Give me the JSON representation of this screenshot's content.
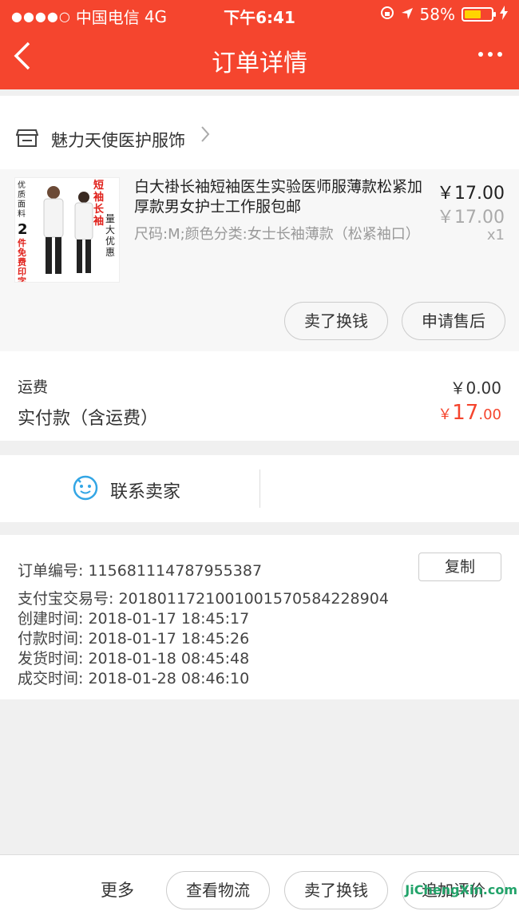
{
  "status_bar": {
    "carrier": "中国电信",
    "network": "4G",
    "time": "下午6:41",
    "battery": "58%"
  },
  "navbar": {
    "title": "订单详情"
  },
  "store": {
    "name": "魅力天使医护服饰"
  },
  "product": {
    "title": "白大褂长袖短袖医生实验医师服薄款松紧加厚款男女护士工作服包邮",
    "sku": "尺码:M;颜色分类:女士长袖薄款（松紧袖口）",
    "price": "￥17.00",
    "original_price": "￥17.00",
    "quantity": "x1",
    "thumbnail_text": {
      "left": "优质面料",
      "count": "2",
      "banner": "件免费印字",
      "red": "短袖 长袖",
      "right": "量大优惠"
    },
    "actions": [
      "卖了换钱",
      "申请售后"
    ]
  },
  "fees": {
    "shipping_label": "运费",
    "shipping_value": "￥0.00",
    "paid_label": "实付款（含运费）",
    "paid_currency": "￥",
    "paid_integer": "17",
    "paid_decimal": ".00"
  },
  "contact": {
    "label": "联系卖家"
  },
  "order_info": {
    "copy_label": "复制",
    "rows": [
      "订单编号:   115681114787955387",
      "支付宝交易号:   20180117210010015705842289​04",
      "创建时间:   2018-01-17 18:45:17",
      "付款时间:   2018-01-17 18:45:26",
      "发货时间:   2018-01-18 08:45:48",
      "成交时间:   2018-01-28 08:46:10"
    ]
  },
  "bottom_bar": {
    "more": "更多",
    "buttons": [
      "查看物流",
      "卖了换钱",
      "追加评价"
    ]
  },
  "watermark": {
    "text": "JiChengXin.com"
  },
  "colors": {
    "brand": "#f5452e",
    "battery": "#ffd400",
    "contact_icon": "#33a6e5"
  }
}
